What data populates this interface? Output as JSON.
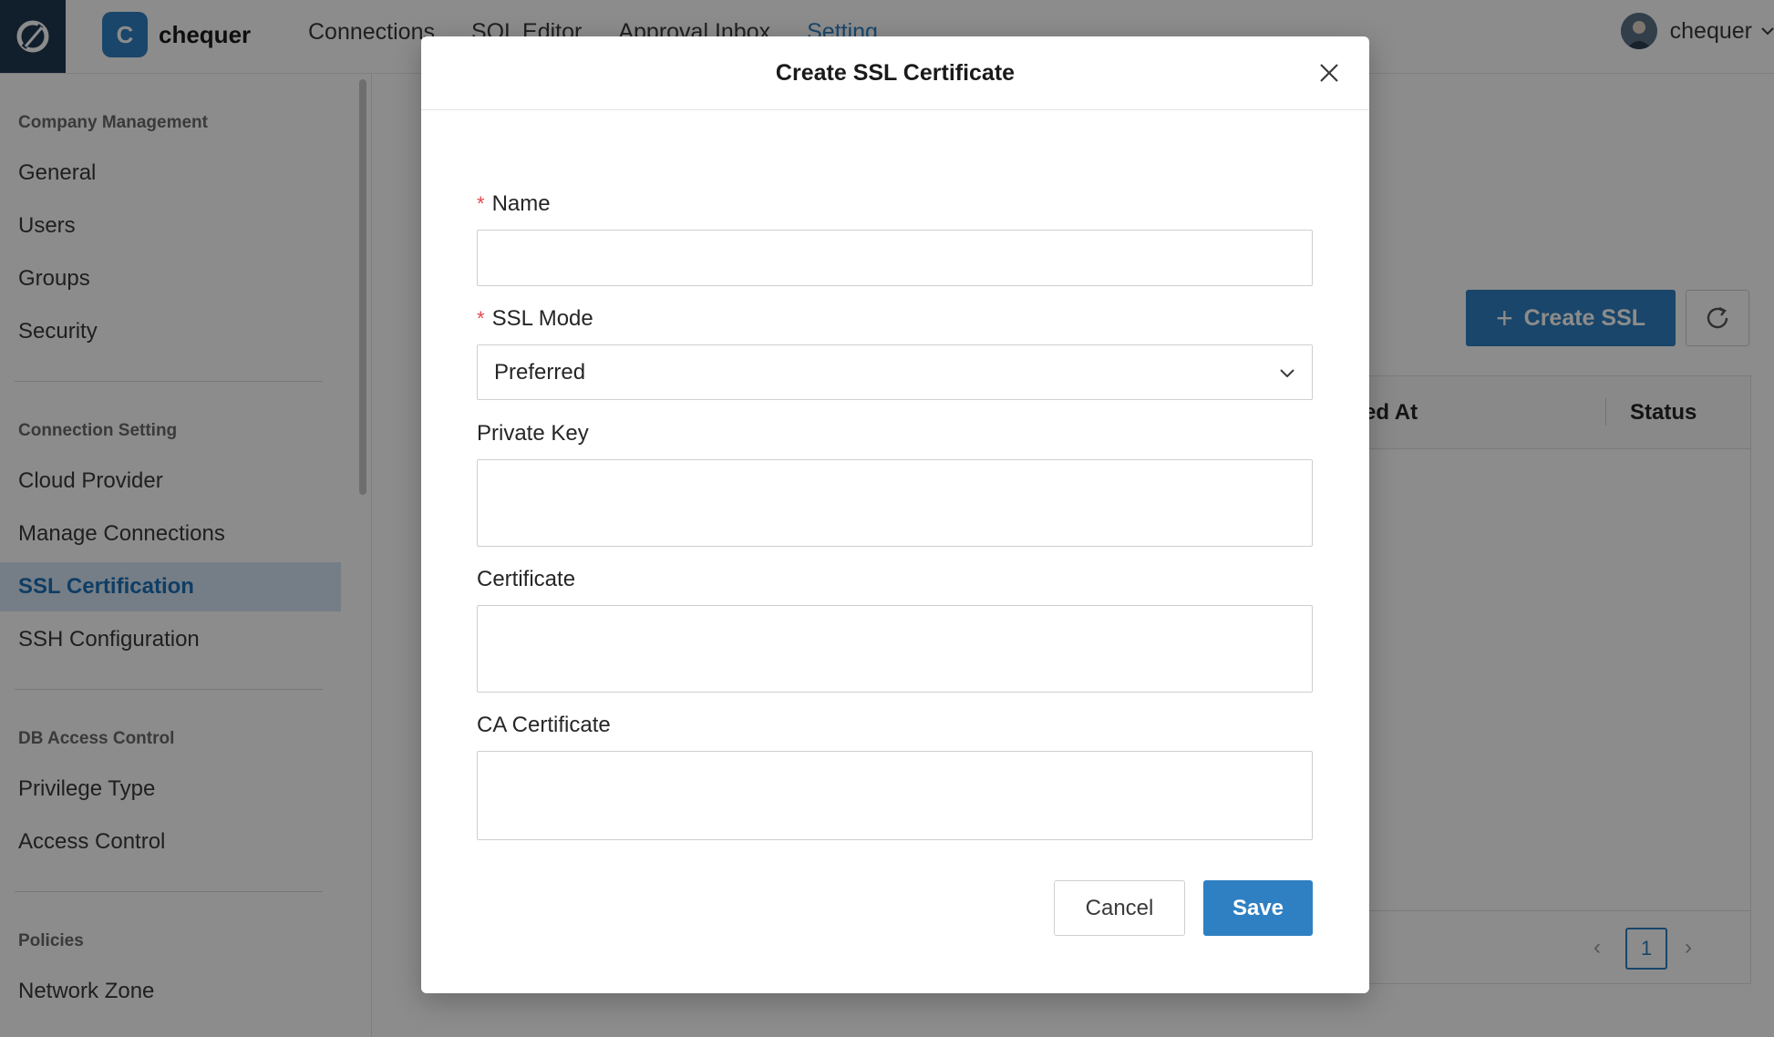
{
  "topbar": {
    "brand_initial": "C",
    "brand_name": "chequer",
    "nav": [
      "Connections",
      "SQL Editor",
      "Approval Inbox",
      "Setting"
    ],
    "active_nav": "Setting",
    "user_name": "chequer"
  },
  "sidebar": {
    "sections": [
      {
        "title": "Company Management",
        "items": [
          "General",
          "Users",
          "Groups",
          "Security"
        ]
      },
      {
        "title": "Connection Setting",
        "items": [
          "Cloud Provider",
          "Manage Connections",
          "SSL Certification",
          "SSH Configuration"
        ]
      },
      {
        "title": "DB Access Control",
        "items": [
          "Privilege Type",
          "Access Control"
        ]
      },
      {
        "title": "Policies",
        "items": [
          "Network Zone"
        ]
      }
    ],
    "active_item": "SSL Certification"
  },
  "background": {
    "create_button_label": "Create SSL",
    "table_col_partial": "ed At",
    "table_col_status": "Status",
    "current_page": "1"
  },
  "modal": {
    "title": "Create SSL Certificate",
    "fields": {
      "name_label": "Name",
      "name_value": "",
      "ssl_mode_label": "SSL Mode",
      "ssl_mode_value": "Preferred",
      "private_key_label": "Private Key",
      "private_key_value": "",
      "certificate_label": "Certificate",
      "certificate_value": "",
      "ca_certificate_label": "CA Certificate",
      "ca_certificate_value": ""
    },
    "required_marker": "*",
    "cancel_label": "Cancel",
    "save_label": "Save"
  },
  "colors": {
    "accent": "#2f80c2",
    "logo_bg": "#1f3a52",
    "required": "#e5484d"
  },
  "icons": [
    "app-logo-icon",
    "chevron-down-icon",
    "close-icon",
    "plus-icon",
    "refresh-icon",
    "chevron-left-icon",
    "chevron-right-icon"
  ]
}
